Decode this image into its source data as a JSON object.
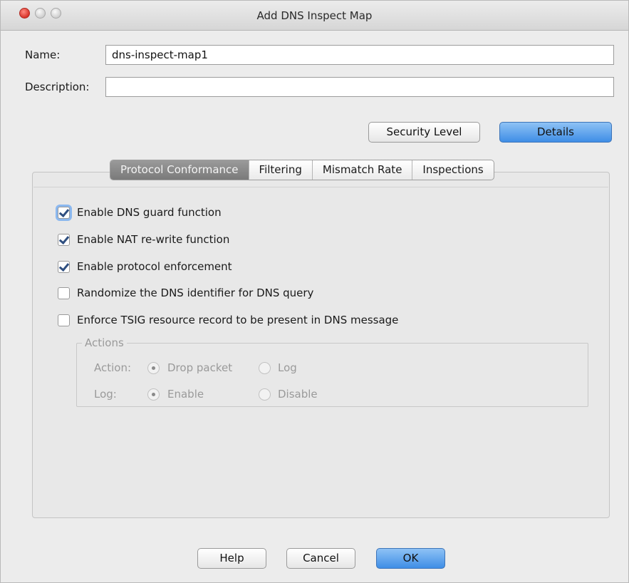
{
  "window": {
    "title": "Add DNS Inspect Map"
  },
  "form": {
    "name_label": "Name:",
    "name_value": "dns-inspect-map1",
    "description_label": "Description:",
    "description_value": ""
  },
  "view_buttons": {
    "security_level": "Security Level",
    "details": "Details"
  },
  "tabs": [
    {
      "label": "Protocol Conformance",
      "active": true
    },
    {
      "label": "Filtering",
      "active": false
    },
    {
      "label": "Mismatch Rate",
      "active": false
    },
    {
      "label": "Inspections",
      "active": false
    }
  ],
  "options": [
    {
      "label": "Enable DNS guard function",
      "checked": true
    },
    {
      "label": "Enable NAT re-write function",
      "checked": true
    },
    {
      "label": "Enable protocol enforcement",
      "checked": true
    },
    {
      "label": "Randomize the DNS identifier for DNS query",
      "checked": false
    },
    {
      "label": "Enforce TSIG resource record to be present in DNS message",
      "checked": false
    }
  ],
  "actions": {
    "legend": "Actions",
    "action_label": "Action:",
    "action_options": [
      {
        "label": "Drop packet",
        "selected": true
      },
      {
        "label": "Log",
        "selected": false
      }
    ],
    "log_label": "Log:",
    "log_options": [
      {
        "label": "Enable",
        "selected": true
      },
      {
        "label": "Disable",
        "selected": false
      }
    ]
  },
  "footer": {
    "help": "Help",
    "cancel": "Cancel",
    "ok": "OK"
  }
}
